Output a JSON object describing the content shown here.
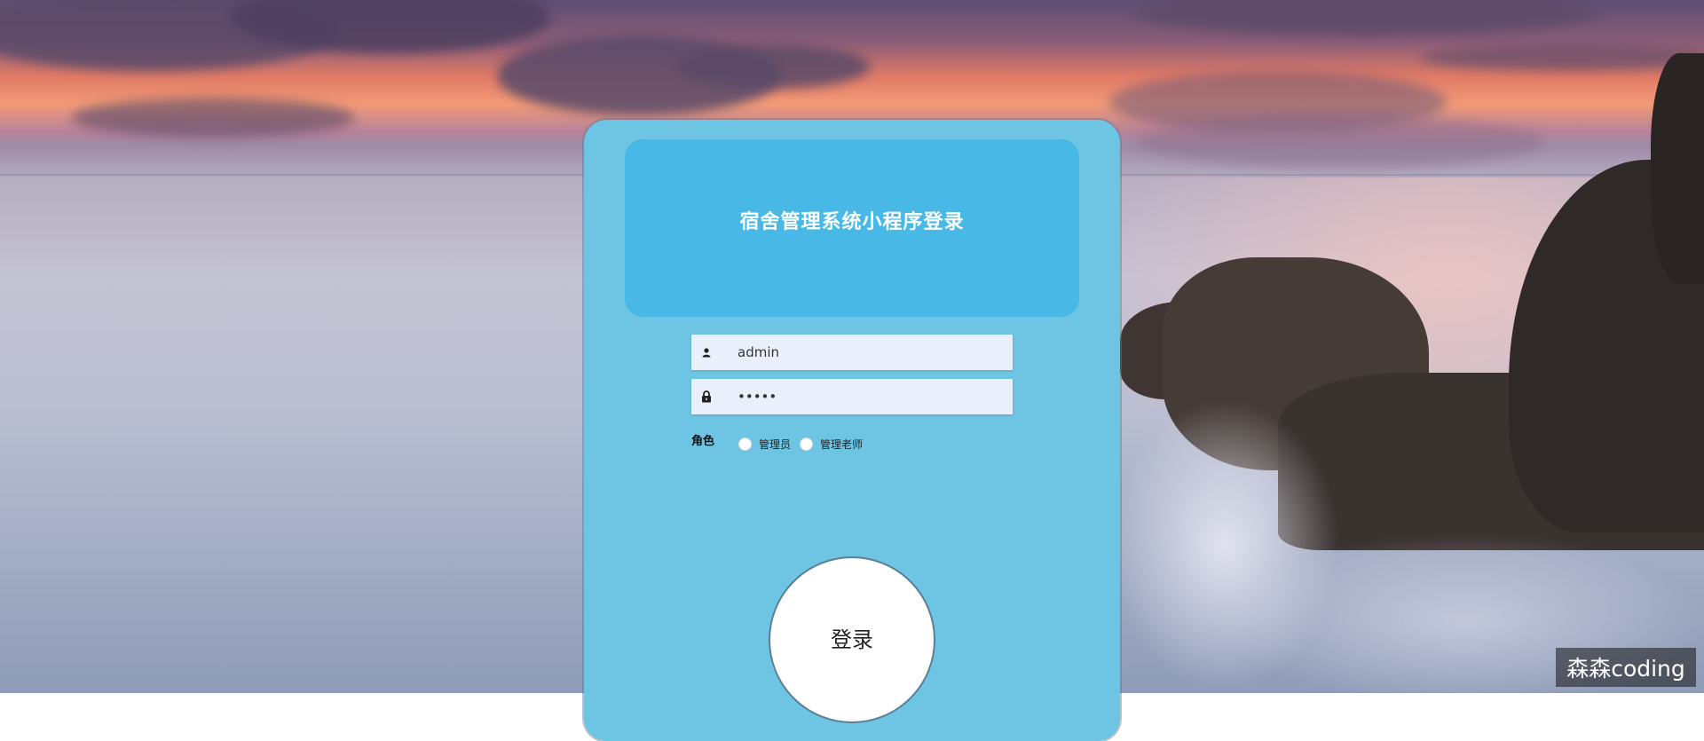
{
  "login": {
    "title": "宿舍管理系统小程序登录",
    "username_value": "admin",
    "password_value": "•••••",
    "role_label": "角色",
    "roles": [
      "管理员",
      "管理老师"
    ],
    "submit_label": "登录"
  },
  "watermark": {
    "text": "森森coding"
  },
  "colors": {
    "card": "#6ec4e3",
    "header": "#48b8e6",
    "field": "#e9f0fc",
    "button": "#ffffff"
  },
  "icons": {
    "username": "user-icon",
    "password": "lock-icon"
  }
}
